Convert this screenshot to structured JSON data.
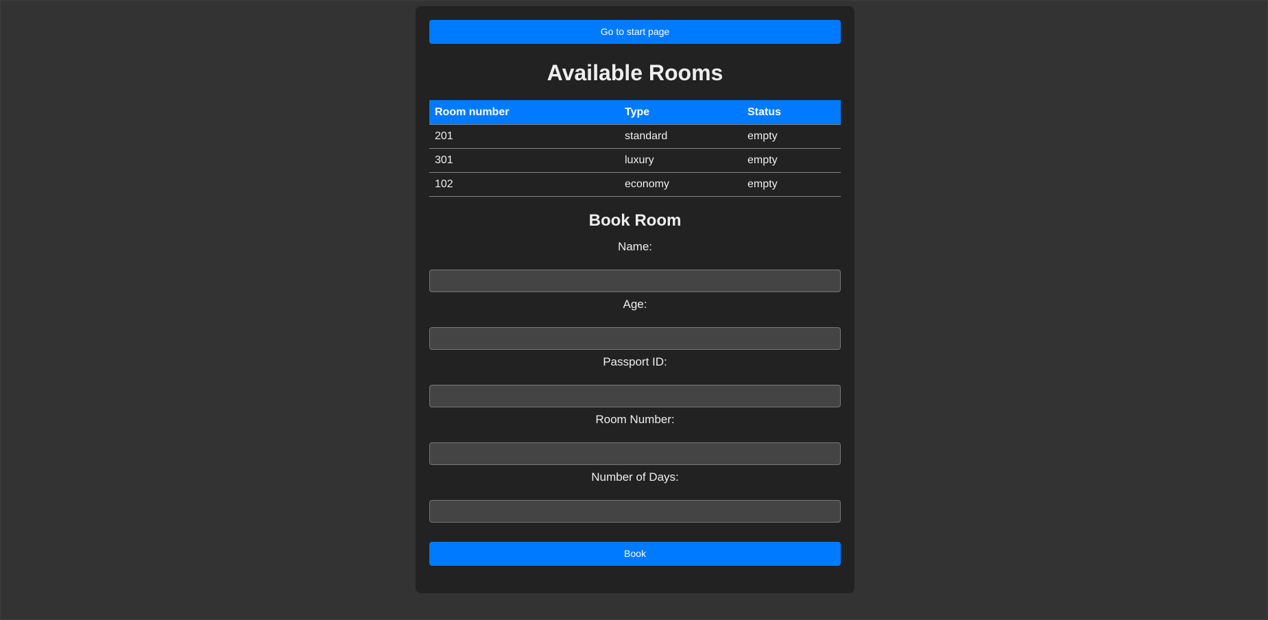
{
  "nav": {
    "start_label": "Go to start page"
  },
  "title": "Available Rooms",
  "table": {
    "headers": [
      "Room number",
      "Type",
      "Status"
    ],
    "rows": [
      [
        "201",
        "standard",
        "empty"
      ],
      [
        "301",
        "luxury",
        "empty"
      ],
      [
        "102",
        "economy",
        "empty"
      ]
    ]
  },
  "booking": {
    "title": "Book Room",
    "fields": [
      {
        "label": "Name:",
        "value": ""
      },
      {
        "label": "Age:",
        "value": ""
      },
      {
        "label": "Passport ID:",
        "value": ""
      },
      {
        "label": "Room Number:",
        "value": ""
      },
      {
        "label": "Number of Days:",
        "value": ""
      }
    ],
    "submit_label": "Book"
  },
  "colors": {
    "accent": "#007bff",
    "background": "#333333",
    "card": "#222222",
    "input": "#444444"
  }
}
